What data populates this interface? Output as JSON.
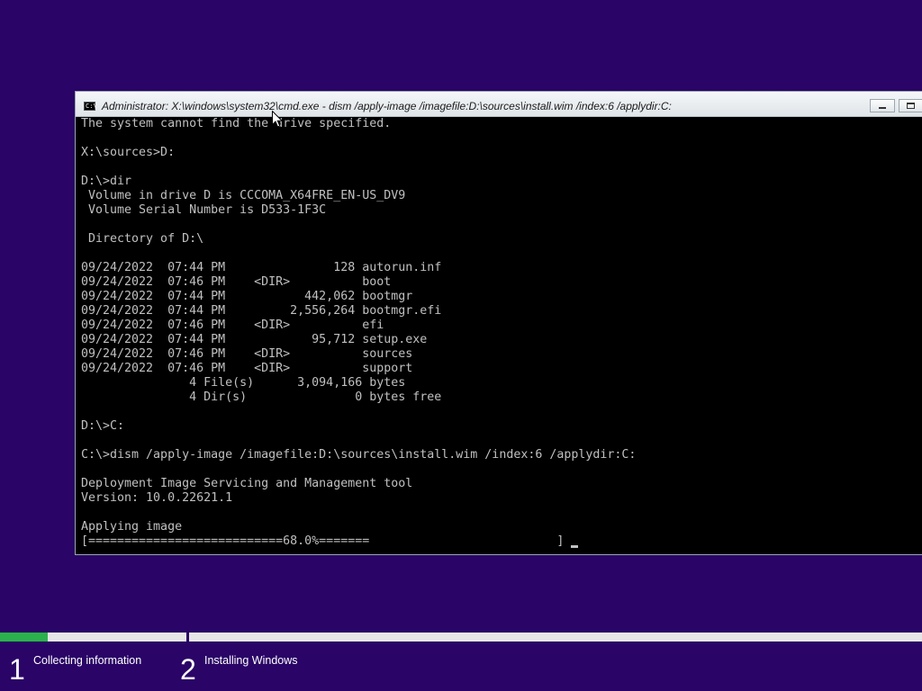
{
  "window": {
    "title": "Administrator: X:\\windows\\system32\\cmd.exe - dism  /apply-image /imagefile:D:\\sources\\install.wim /index:6 /applydir:C:",
    "icon_name": "cmd-icon",
    "icon_label": "C:\\"
  },
  "console": {
    "lines": [
      "The system cannot find the drive specified.",
      "",
      "X:\\sources>D:",
      "",
      "D:\\>dir",
      " Volume in drive D is CCCOMA_X64FRE_EN-US_DV9",
      " Volume Serial Number is D533-1F3C",
      "",
      " Directory of D:\\",
      "",
      "09/24/2022  07:44 PM               128 autorun.inf",
      "09/24/2022  07:46 PM    <DIR>          boot",
      "09/24/2022  07:44 PM           442,062 bootmgr",
      "09/24/2022  07:44 PM         2,556,264 bootmgr.efi",
      "09/24/2022  07:46 PM    <DIR>          efi",
      "09/24/2022  07:44 PM            95,712 setup.exe",
      "09/24/2022  07:46 PM    <DIR>          sources",
      "09/24/2022  07:46 PM    <DIR>          support",
      "               4 File(s)      3,094,166 bytes",
      "               4 Dir(s)               0 bytes free",
      "",
      "D:\\>C:",
      "",
      "C:\\>dism /apply-image /imagefile:D:\\sources\\install.wim /index:6 /applydir:C:",
      "",
      "Deployment Image Servicing and Management tool",
      "Version: 10.0.22621.1",
      "",
      "Applying image",
      "[===========================68.0%=======                          ]"
    ]
  },
  "setup_progress": {
    "fraction": 0.052,
    "steps": [
      {
        "number": "1",
        "label": "Collecting information"
      },
      {
        "number": "2",
        "label": "Installing Windows"
      }
    ]
  },
  "colors": {
    "background": "#2a0466",
    "progress_fill": "#2bb24c",
    "console_text": "#c0c0c0"
  }
}
